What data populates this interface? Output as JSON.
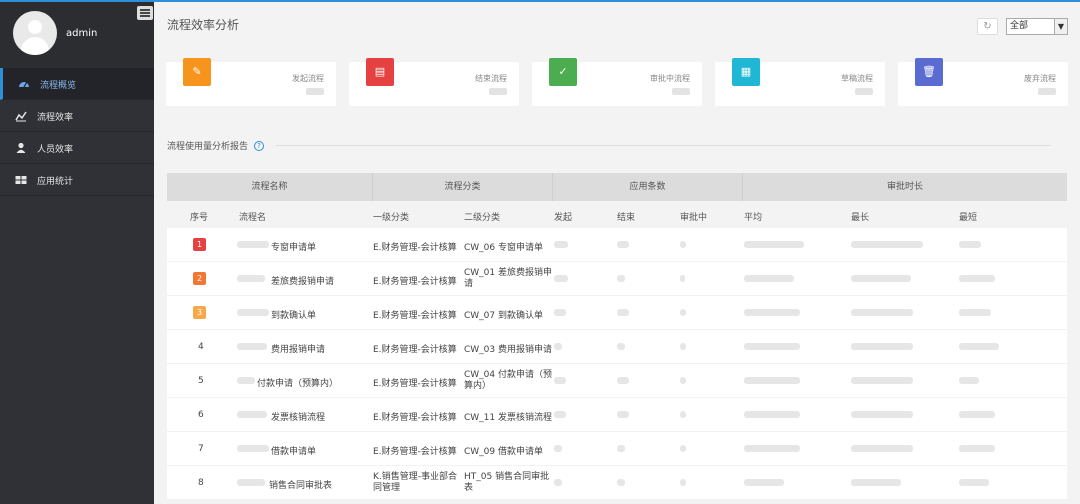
{
  "sidebar": {
    "username": "admin",
    "items": [
      {
        "label": "流程概览",
        "active": true,
        "icon": "dashboard-icon"
      },
      {
        "label": "流程效率",
        "active": false,
        "icon": "line-chart-icon"
      },
      {
        "label": "人员效率",
        "active": false,
        "icon": "user-icon"
      },
      {
        "label": "应用统计",
        "active": false,
        "icon": "grid-icon"
      }
    ]
  },
  "header": {
    "title": "流程效率分析",
    "filter_selected": "全部"
  },
  "cards": [
    {
      "label": "发起流程",
      "color": "#f7941d",
      "icon": "pencil-icon"
    },
    {
      "label": "结束流程",
      "color": "#e64141",
      "icon": "finish-doc-icon"
    },
    {
      "label": "审批中流程",
      "color": "#4cad50",
      "icon": "approve-icon"
    },
    {
      "label": "草稿流程",
      "color": "#1fb7d3",
      "icon": "draft-doc-icon"
    },
    {
      "label": "废弃流程",
      "color": "#5a6bd1",
      "icon": "trash-icon"
    }
  ],
  "section": {
    "title": "流程使用量分析报告"
  },
  "table": {
    "groups": [
      "流程名称",
      "流程分类",
      "应用条数",
      "审批时长"
    ],
    "columns": [
      "序号",
      "流程名",
      "一级分类",
      "二级分类",
      "发起",
      "结束",
      "审批中",
      "平均",
      "最长",
      "最短"
    ],
    "rows": [
      {
        "no": "1",
        "name": "专窗申请单",
        "cat1": "E.财务管理-会计核算",
        "cat2": "CW_06 专窗申请单",
        "rank_color": "#e64141"
      },
      {
        "no": "2",
        "name": "差旅费报销申请",
        "cat1": "E.财务管理-会计核算",
        "cat2a": "CW_01 差旅费报销申",
        "cat2b": "请",
        "rank_color": "#f27735"
      },
      {
        "no": "3",
        "name": "到款确认单",
        "cat1": "E.财务管理-会计核算",
        "cat2": "CW_07 到款确认单",
        "rank_color": "#f7a84b"
      },
      {
        "no": "4",
        "name": "费用报销申请",
        "cat1": "E.财务管理-会计核算",
        "cat2": "CW_03 费用报销申请"
      },
      {
        "no": "5",
        "name": "付款申请（预算内）",
        "cat1": "E.财务管理-会计核算",
        "cat2a": "CW_04 付款申请（预",
        "cat2b": "算内）"
      },
      {
        "no": "6",
        "name": "发票核销流程",
        "cat1": "E.财务管理-会计核算",
        "cat2": "CW_11 发票核销流程"
      },
      {
        "no": "7",
        "name": "借款申请单",
        "cat1": "E.财务管理-会计核算",
        "cat2": "CW_09 借款申请单"
      },
      {
        "no": "8",
        "name": "销售合同审批表",
        "cat1a": "K.销售管理-事业部合",
        "cat1b": "同管理",
        "cat2a": "HT_05 销售合同审批",
        "cat2b": "表"
      }
    ]
  }
}
